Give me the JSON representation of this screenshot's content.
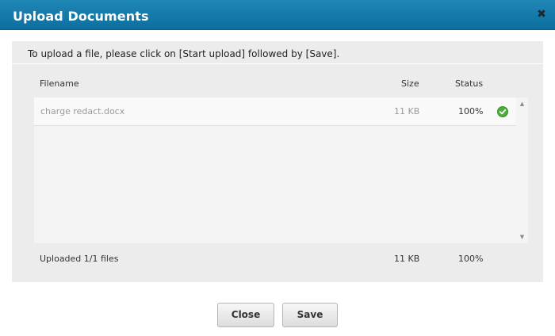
{
  "dialog": {
    "title": "Upload Documents",
    "close_icon": "close-icon"
  },
  "panel": {
    "instructions": "To upload a file, please click on [Start upload] followed by [Save].",
    "columns": {
      "filename": "Filename",
      "size": "Size",
      "status": "Status"
    },
    "files": [
      {
        "filename": "charge redact.docx",
        "size": "11 KB",
        "status": "100%",
        "status_icon": "check-circle-icon"
      }
    ],
    "summary": {
      "label": "Uploaded 1/1 files",
      "size": "11 KB",
      "status": "100%"
    }
  },
  "buttons": {
    "close": "Close",
    "save": "Save"
  },
  "colors": {
    "titlebar": "#0d6f9f",
    "panel": "#ececec",
    "success": "#4caf3a"
  }
}
